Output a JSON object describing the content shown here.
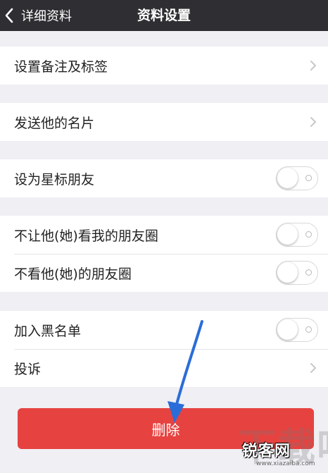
{
  "nav": {
    "back_label": "详细资料",
    "title": "资料设置"
  },
  "groups": [
    {
      "items": [
        {
          "label": "设置备注及标签",
          "type": "chevron"
        }
      ]
    },
    {
      "items": [
        {
          "label": "发送他的名片",
          "type": "chevron"
        }
      ]
    },
    {
      "items": [
        {
          "label": "设为星标朋友",
          "type": "toggle",
          "on": false
        }
      ]
    },
    {
      "items": [
        {
          "label": "不让他(她)看我的朋友圈",
          "type": "toggle",
          "on": false
        },
        {
          "label": "不看他(她)的朋友圈",
          "type": "toggle",
          "on": false
        }
      ]
    },
    {
      "items": [
        {
          "label": "加入黑名单",
          "type": "toggle",
          "on": false
        },
        {
          "label": "投诉",
          "type": "chevron"
        }
      ]
    }
  ],
  "delete_button": {
    "label": "删除"
  },
  "watermark": {
    "big": "下载吧",
    "logo": "锐客网",
    "url": "www.xiazaiba.com"
  },
  "colors": {
    "nav_bg": "#2f2f33",
    "danger": "#e64340",
    "annotation_arrow": "#2a6dd8"
  }
}
